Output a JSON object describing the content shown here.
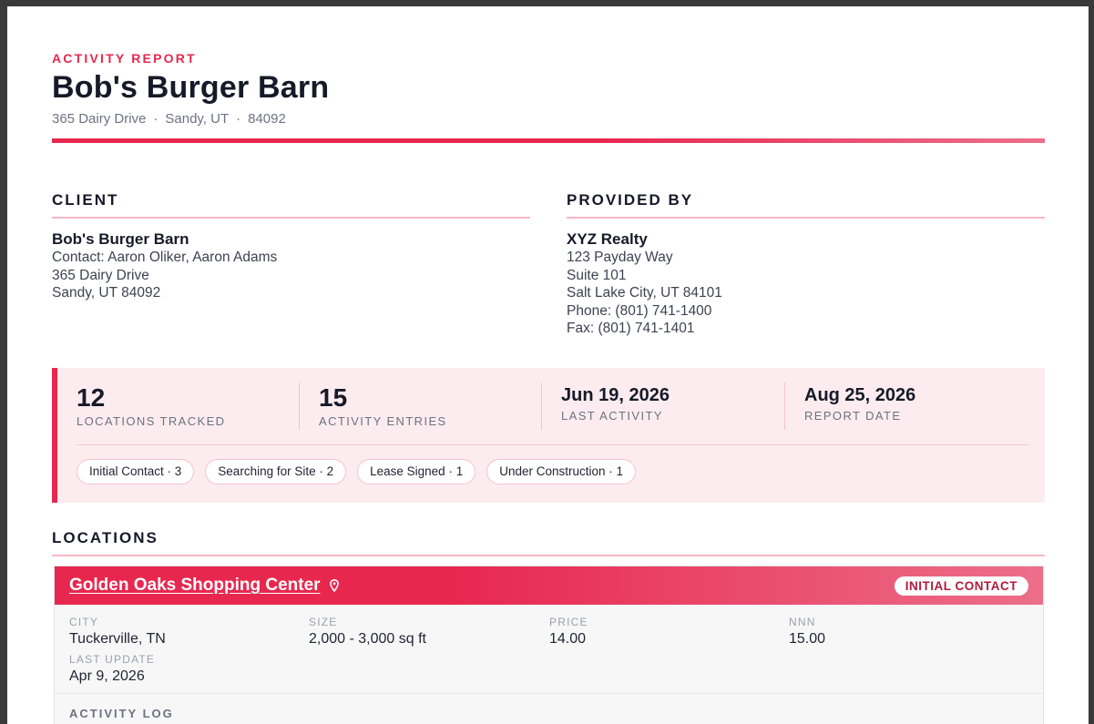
{
  "header": {
    "eyebrow": "ACTIVITY REPORT",
    "title": "Bob's Burger Barn",
    "address": {
      "street": "365 Dairy Drive",
      "city_state": "Sandy, UT",
      "zip": "84092",
      "separator": "·"
    }
  },
  "client": {
    "heading": "CLIENT",
    "name": "Bob's Burger Barn",
    "lines": [
      "Contact: Aaron Oliker, Aaron Adams",
      "365 Dairy Drive",
      "Sandy, UT 84092"
    ]
  },
  "provider": {
    "heading": "PROVIDED BY",
    "name": "XYZ Realty",
    "lines": [
      "123 Payday Way",
      "Suite 101",
      "Salt Lake City, UT 84101",
      "Phone: (801) 741-1400",
      "Fax: (801) 741-1401"
    ]
  },
  "stats": [
    {
      "value": "12",
      "label": "LOCATIONS TRACKED"
    },
    {
      "value": "15",
      "label": "ACTIVITY ENTRIES"
    },
    {
      "value": "Jun 19, 2026",
      "label": "LAST ACTIVITY"
    },
    {
      "value": "Aug 25, 2026",
      "label": "REPORT DATE"
    }
  ],
  "chips": [
    "Initial Contact · 3",
    "Searching for Site · 2",
    "Lease Signed · 1",
    "Under Construction · 1"
  ],
  "locations_heading": "LOCATIONS",
  "location": {
    "name": "Golden Oaks Shopping Center",
    "status": "INITIAL CONTACT",
    "fields": {
      "city": {
        "label": "CITY",
        "value": "Tuckerville, TN"
      },
      "size": {
        "label": "SIZE",
        "value": "2,000 - 3,000 sq ft"
      },
      "price": {
        "label": "PRICE",
        "value": "14.00"
      },
      "nnn": {
        "label": "NNN",
        "value": "15.00"
      },
      "last_update": {
        "label": "LAST UPDATE",
        "value": "Apr 9, 2026"
      }
    },
    "activity_log_label": "ACTIVITY LOG"
  },
  "colors": {
    "accent": "#e8274f",
    "accent_light": "#fdecef",
    "status_text": "#b01b3d"
  }
}
